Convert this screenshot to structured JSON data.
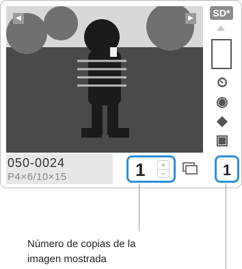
{
  "top": {
    "left_arrow_icon": "triangle-left-icon",
    "right_arrow_icon": "triangle-right-icon",
    "sd_label": "SD*"
  },
  "sidebar": {
    "up_icon": "triangle-up-icon",
    "paper_icon": "paper-outline-icon",
    "icons": [
      "clock-x-icon",
      "eye-x-icon",
      "diamond-x-icon",
      "image-icon"
    ]
  },
  "bottom": {
    "file_number": "050-0024",
    "print_size": "P4×6/10×15",
    "copies_value": "1",
    "stepper_plus": "+",
    "stepper_minus": "−",
    "print_icon": "printer-icon",
    "total_value": "1"
  },
  "caption": {
    "line1": "Número de copias de la",
    "line2": "imagen mostrada"
  },
  "colors": {
    "accent": "#2f8fd6",
    "frame": "#b9b9b9"
  }
}
